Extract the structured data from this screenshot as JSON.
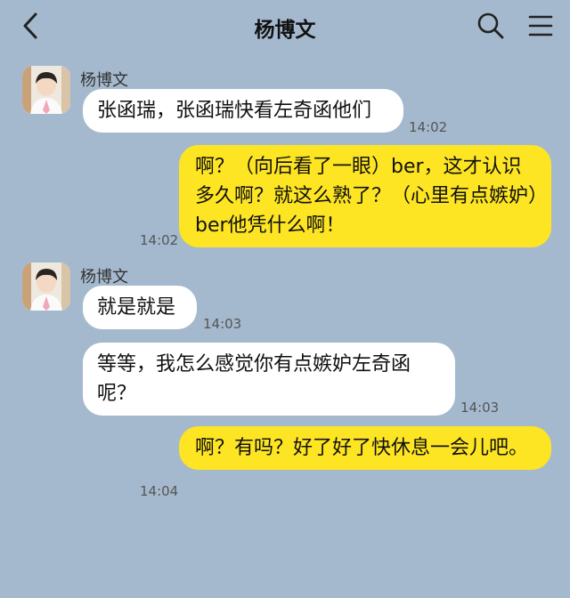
{
  "header": {
    "title": "杨博文"
  },
  "colors": {
    "background": "#a5b9ce",
    "incoming_bubble": "#ffffff",
    "outgoing_bubble": "#fde523"
  },
  "icons": {
    "back": "chevron-left-icon",
    "search": "search-icon",
    "menu": "menu-icon"
  },
  "messages": [
    {
      "direction": "in",
      "sender": "杨博文",
      "text": "张函瑞，张函瑞快看左奇函他们",
      "time": "14:02"
    },
    {
      "direction": "out",
      "text": "啊？（向后看了一眼）ber，这才认识多久啊？就这么熟了？（心里有点嫉妒）ber他凭什么啊！",
      "time": "14:02"
    },
    {
      "direction": "in",
      "sender": "杨博文",
      "text": "就是就是",
      "time": "14:03"
    },
    {
      "direction": "in",
      "text": "等等，我怎么感觉你有点嫉妒左奇函呢？",
      "time": "14:03"
    },
    {
      "direction": "out",
      "text": "啊？有吗？好了好了快休息一会儿吧。",
      "time": "14:04"
    }
  ]
}
